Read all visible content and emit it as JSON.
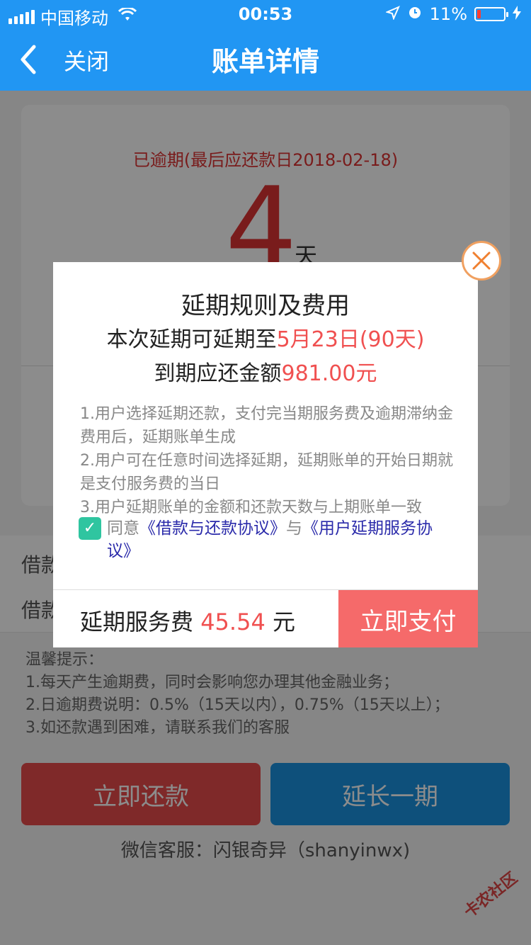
{
  "status": {
    "carrier": "中国移动",
    "time": "00:53",
    "battery": "11%"
  },
  "nav": {
    "back_icon": "chevron-left-icon",
    "close_label": "关闭",
    "title": "账单详情"
  },
  "bill": {
    "overdue_text": "已逾期(最后应还款日2018-02-18)",
    "overdue_days": "4",
    "day_unit": "天",
    "row1_label": "借款",
    "row2_label": "借款"
  },
  "tips": {
    "title": "温馨提示：",
    "line1": "1.每天产生逾期费，同时会影响您办理其他金融业务；",
    "line2": "2.日逾期费说明：0.5%（15天以内），0.75%（15天以上）；",
    "line3": "3.如还款遇到困难，请联系我们的客服"
  },
  "buttons": {
    "repay": "立即还款",
    "extend": "延长一期"
  },
  "wechat": "微信客服：闪银奇异（shanyinwx)",
  "watermark": "卡农社区",
  "modal": {
    "title": "延期规则及费用",
    "extend_prefix": "本次延期可延期至",
    "extend_date": "5月23日(90天)",
    "due_prefix": "到期应还金额",
    "due_amount": "981.00元",
    "rule1": "1.用户选择延期还款，支付完当期服务费及逾期滞纳金费用后，延期账单生成",
    "rule2": "2.用户可在任意时间选择延期，延期账单的开始日期就是支付服务费的当日",
    "rule3": "3.用户延期账单的金额和还款天数与上期账单一致",
    "agree_prefix": "同意",
    "agreement1": "《借款与还款协议》",
    "agree_and": "与",
    "agreement2": "《用户延期服务协议》",
    "fee_label": "延期服务费",
    "fee_amount": "45.54",
    "fee_unit": "元",
    "pay_button": "立即支付"
  },
  "colors": {
    "nav_blue": "#2196f3",
    "accent_red": "#f05050",
    "check_green": "#2fc5a0",
    "link_blue": "#2a2aaa"
  }
}
